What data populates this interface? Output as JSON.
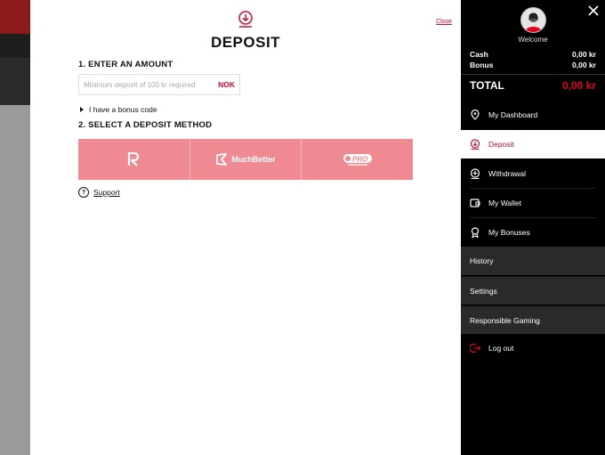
{
  "modal": {
    "title": "DEPOSIT",
    "close_label": "Close",
    "step1_label": "1. ENTER AN AMOUNT",
    "amount_placeholder": "Minimum deposit of 100 kr required",
    "currency": "NOK",
    "bonus_code_label": "I have a bonus code",
    "step2_label": "2. SELECT A DEPOSIT METHOD",
    "methods": [
      {
        "name": "Revolut",
        "icon": "revolut-icon"
      },
      {
        "name": "MuchBetter",
        "icon": "muchbetter-icon"
      },
      {
        "name": "ePRO",
        "icon": "epro-icon"
      }
    ],
    "support_label": "Support",
    "accent_color": "#c8102e",
    "methods_bg_color": "#ef8a93"
  },
  "sidebar": {
    "welcome": "Welcome",
    "cash_label": "Cash",
    "cash_value": "0,00 kr",
    "bonus_label": "Bonus",
    "bonus_value": "0,00 kr",
    "total_label": "TOTAL",
    "total_value": "0,00 kr",
    "menu": [
      {
        "label": "My Dashboard",
        "icon": "location-pin-icon"
      },
      {
        "label": "Deposit",
        "icon": "deposit-icon",
        "active": true
      },
      {
        "label": "Withdrawal",
        "icon": "withdrawal-icon"
      },
      {
        "label": "My Wallet",
        "icon": "wallet-icon"
      },
      {
        "label": "My Bonuses",
        "icon": "bonus-medal-icon"
      },
      {
        "label": "History"
      },
      {
        "label": "Settings"
      },
      {
        "label": "Responsible Gaming"
      },
      {
        "label": "Log out",
        "icon": "logout-icon"
      }
    ],
    "total_color": "#e3001b"
  }
}
